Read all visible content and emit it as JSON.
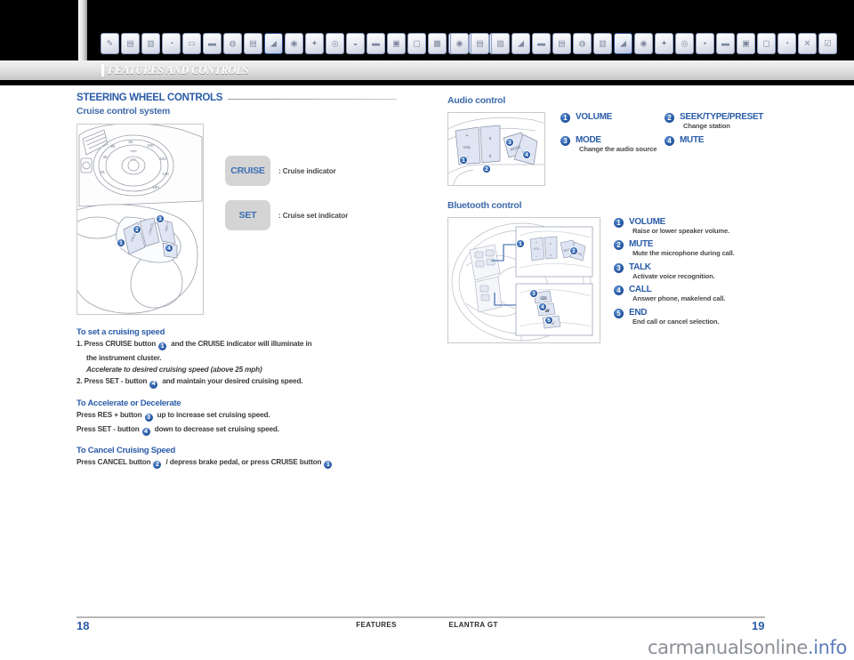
{
  "header": {
    "section_label": "FEATURES AND CONTROLS",
    "left_tabs": [
      {
        "name": "tab-icon-1",
        "glyph": "✎"
      },
      {
        "name": "tab-icon-2",
        "glyph": "▤"
      },
      {
        "name": "tab-icon-3",
        "glyph": "▥"
      },
      {
        "name": "tab-icon-4",
        "glyph": "◔"
      },
      {
        "name": "tab-icon-5",
        "glyph": "▭"
      },
      {
        "name": "tab-icon-6",
        "glyph": "▬"
      },
      {
        "name": "tab-icon-7",
        "glyph": "◍"
      },
      {
        "name": "tab-icon-8",
        "glyph": "▤"
      },
      {
        "name": "tab-icon-9-active",
        "glyph": "◢",
        "active": true
      },
      {
        "name": "tab-icon-10",
        "glyph": "◉"
      },
      {
        "name": "tab-icon-11",
        "glyph": "✦"
      },
      {
        "name": "tab-icon-12",
        "glyph": "◎"
      },
      {
        "name": "tab-icon-13",
        "glyph": "◒"
      },
      {
        "name": "tab-icon-14",
        "glyph": "▬"
      },
      {
        "name": "tab-icon-15",
        "glyph": "▣"
      },
      {
        "name": "tab-icon-16",
        "glyph": "▢"
      },
      {
        "name": "tab-icon-17",
        "glyph": "▩"
      },
      {
        "name": "tab-icon-18",
        "glyph": "✕"
      },
      {
        "name": "tab-icon-19",
        "glyph": "❂"
      },
      {
        "name": "tab-icon-20",
        "glyph": "➜"
      }
    ],
    "right_tabs": [
      {
        "name": "tab-icon-r1",
        "glyph": "◉"
      },
      {
        "name": "tab-icon-r2",
        "glyph": "▤"
      },
      {
        "name": "tab-icon-r3",
        "glyph": "▨"
      },
      {
        "name": "tab-icon-r4",
        "glyph": "◢"
      },
      {
        "name": "tab-icon-r5",
        "glyph": "▬"
      },
      {
        "name": "tab-icon-r6",
        "glyph": "▤"
      },
      {
        "name": "tab-icon-r7",
        "glyph": "◍"
      },
      {
        "name": "tab-icon-r8",
        "glyph": "▥"
      },
      {
        "name": "tab-icon-r9-active",
        "glyph": "◢",
        "active": true
      },
      {
        "name": "tab-icon-r10",
        "glyph": "◉"
      },
      {
        "name": "tab-icon-r11",
        "glyph": "✦"
      },
      {
        "name": "tab-icon-r12",
        "glyph": "◎"
      },
      {
        "name": "tab-icon-r13",
        "glyph": "▪"
      },
      {
        "name": "tab-icon-r14",
        "glyph": "▬"
      },
      {
        "name": "tab-icon-r15",
        "glyph": "▣"
      },
      {
        "name": "tab-icon-r16",
        "glyph": "▢"
      },
      {
        "name": "tab-icon-r17",
        "glyph": "◔"
      },
      {
        "name": "tab-icon-r18",
        "glyph": "✕"
      },
      {
        "name": "tab-icon-r19",
        "glyph": "☑"
      }
    ]
  },
  "left_page": {
    "title": "STEERING WHEEL CONTROLS",
    "subtitle": "Cruise control system",
    "indicators": [
      {
        "chip": "CRUISE",
        "label": ": Cruise indicator"
      },
      {
        "chip": "SET",
        "label": ": Cruise set indicator"
      }
    ],
    "wheel_callouts": [
      "1",
      "2",
      "3",
      "4"
    ],
    "speedometer": {
      "unit": "mph",
      "ticks": [
        "20",
        "40",
        "60",
        "80",
        "100",
        "120",
        "140",
        "160"
      ],
      "inner_unit": "km/h"
    },
    "sections": [
      {
        "heading": "To set a cruising speed",
        "lines": [
          {
            "text_before": "1. Press CRUISE button",
            "badge": "1",
            "text_after": "and the CRUISE indicator will illuminate in",
            "style": "normal"
          },
          {
            "text_before": "the instrument cluster.",
            "badge": "",
            "text_after": "",
            "style": "indent"
          },
          {
            "text_before": "Accelerate to desired cruising speed (above 25 mph)",
            "badge": "",
            "text_after": "",
            "style": "indent-italic"
          },
          {
            "text_before": "2. Press SET - button",
            "badge": "4",
            "text_after": "and maintain your desired cruising speed.",
            "style": "normal"
          }
        ]
      },
      {
        "heading": "To Accelerate or Decelerate",
        "lines": [
          {
            "text_before": "Press RES + button",
            "badge": "3",
            "text_after": "up to increase set cruising speed.",
            "style": "normal"
          },
          {
            "text_before": "Press SET - button",
            "badge": "4",
            "text_after": "down to decrease set cruising speed.",
            "style": "normal"
          }
        ]
      },
      {
        "heading": "To Cancel Cruising Speed",
        "lines": [
          {
            "text_before": "Press CANCEL button",
            "badge": "2",
            "text_after": "/ depress brake pedal, or press CRUISE button",
            "style": "normal",
            "badge_end": "1"
          }
        ]
      }
    ]
  },
  "right_page": {
    "audio": {
      "heading": "Audio control",
      "buttons": [
        "+",
        "VOL",
        "–",
        "∧",
        "∨",
        "MODE",
        "MUTE"
      ],
      "callouts": [
        "1",
        "2",
        "3",
        "4"
      ],
      "legend": [
        {
          "num": "1",
          "title": "VOLUME",
          "desc": ""
        },
        {
          "num": "2",
          "title": "SEEK/TYPE/PRESET",
          "desc": "Change station"
        },
        {
          "num": "3",
          "title": "MODE",
          "desc": "Change the audio source"
        },
        {
          "num": "4",
          "title": "MUTE",
          "desc": ""
        }
      ]
    },
    "bluetooth": {
      "heading": "Bluetooth control",
      "callouts": [
        "1",
        "2",
        "3",
        "4",
        "5"
      ],
      "legend": [
        {
          "num": "1",
          "title": "VOLUME",
          "desc": "Raise or lower speaker volume."
        },
        {
          "num": "2",
          "title": "MUTE",
          "desc": "Mute the microphone during call."
        },
        {
          "num": "3",
          "title": "TALK",
          "desc": "Activate voice recognition."
        },
        {
          "num": "4",
          "title": "CALL",
          "desc": "Answer phone, make/end call."
        },
        {
          "num": "5",
          "title": "END",
          "desc": "End call or cancel selection."
        }
      ]
    }
  },
  "footer": {
    "page_left": "18",
    "page_right": "19",
    "center_left": "FEATURES",
    "center_right": "ELANTRA GT",
    "watermark_prefix": "carmanualsonline",
    "watermark_suffix": ".info"
  },
  "colors": {
    "accent_blue": "#2a5ca8",
    "heading_blue": "#3f6bab",
    "chip_bg": "#d4d4d4",
    "band_black": "#000000"
  }
}
